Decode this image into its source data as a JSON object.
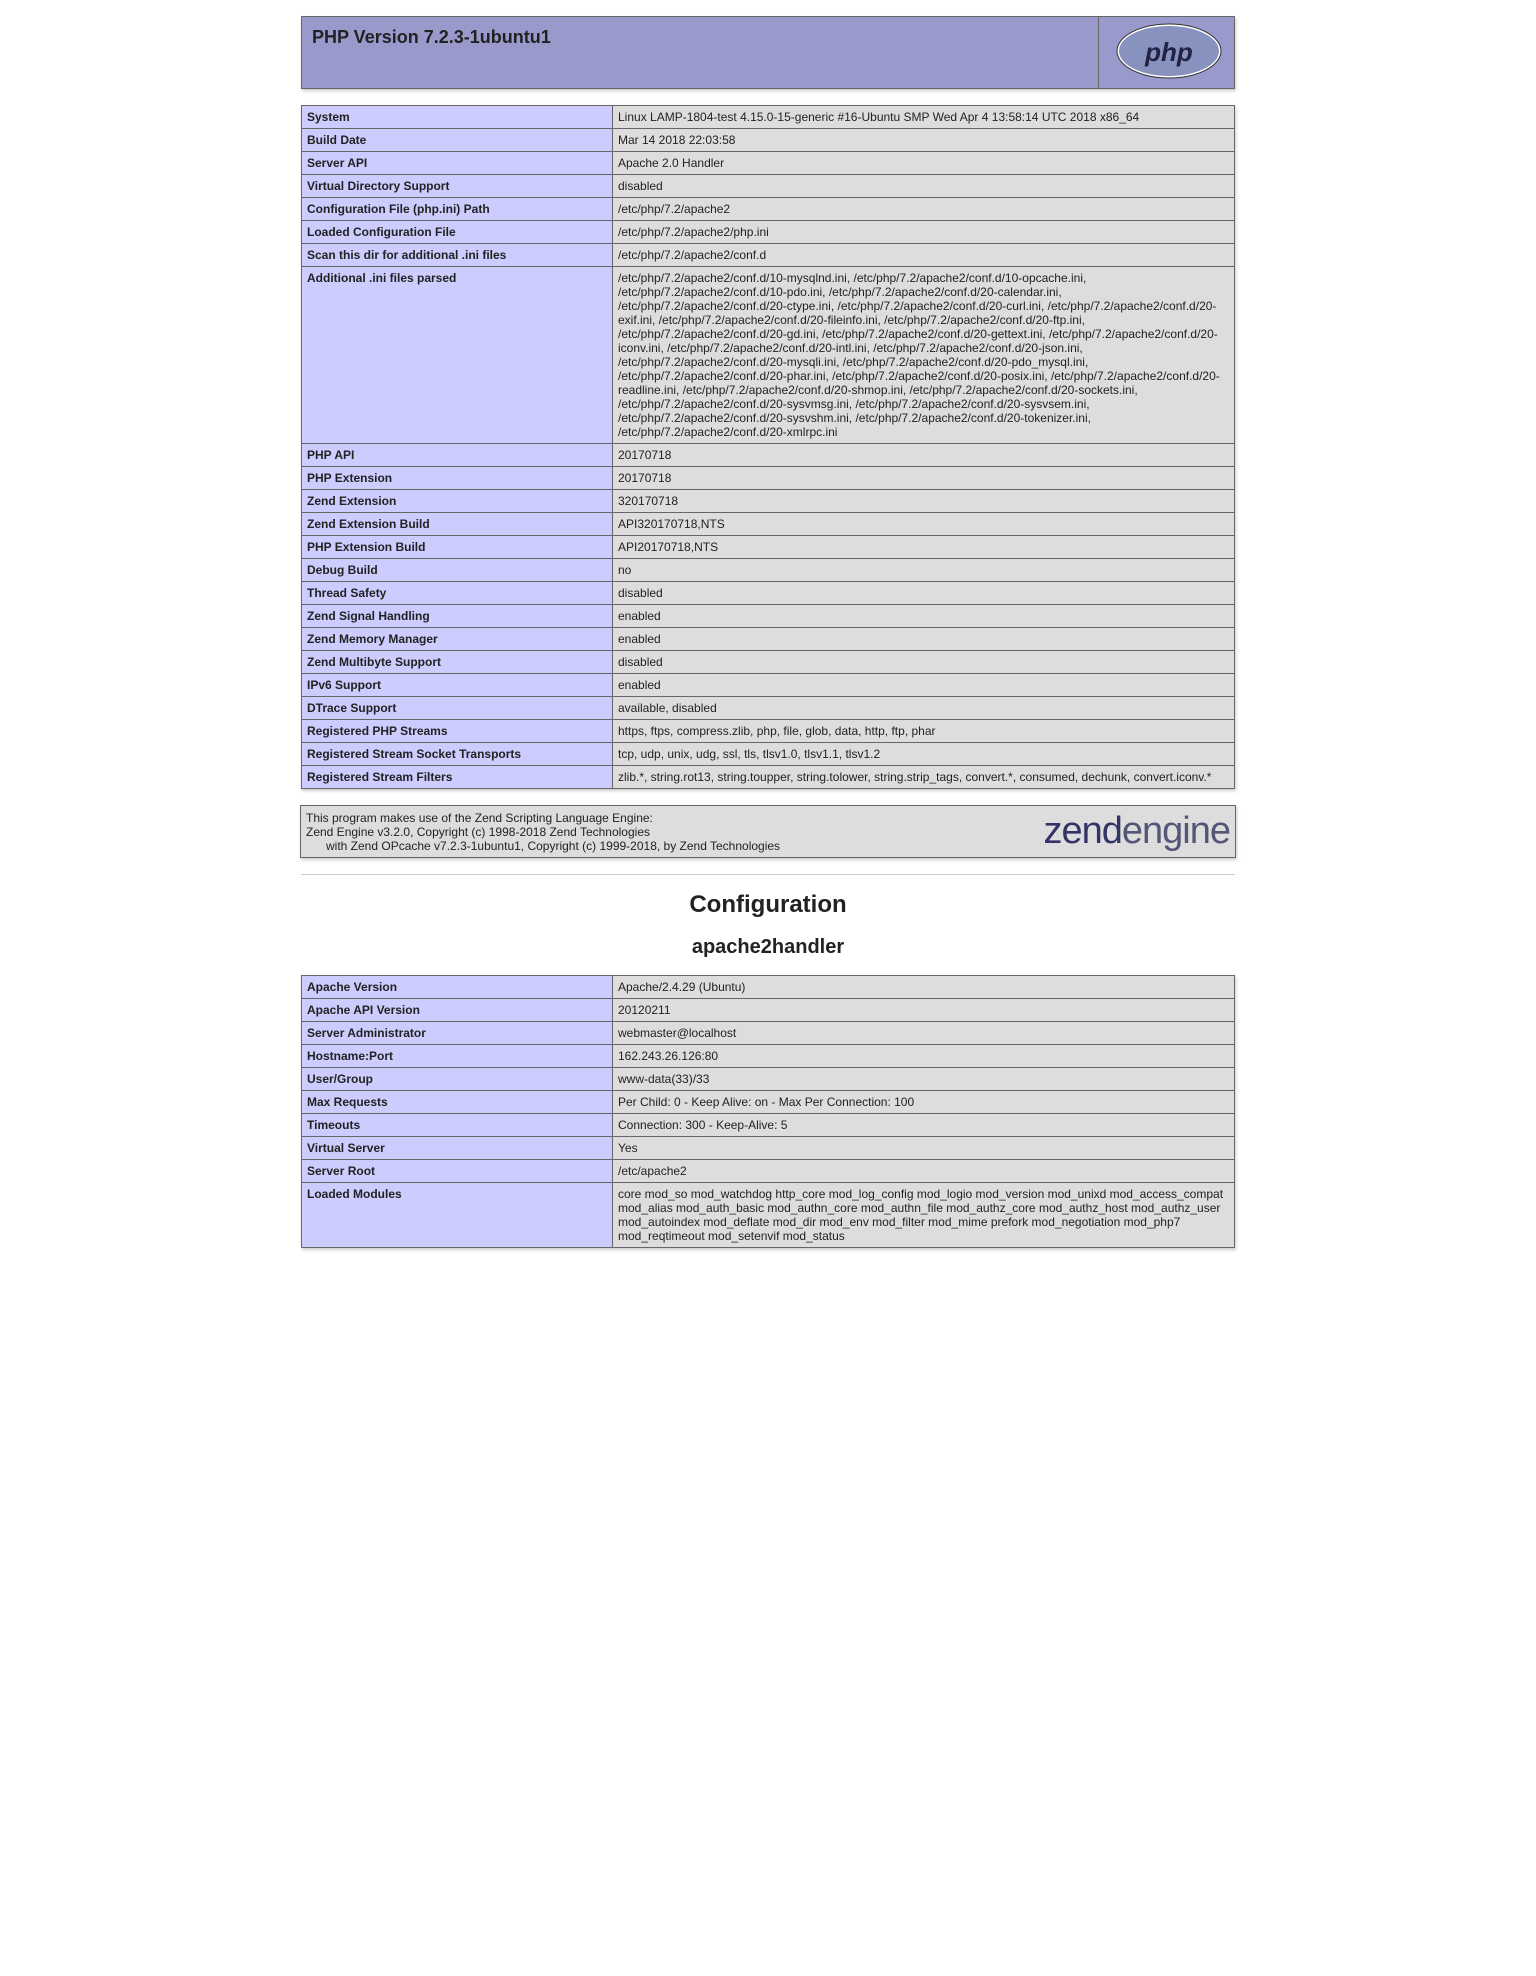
{
  "header": {
    "title": "PHP Version 7.2.3-1ubuntu1"
  },
  "main_table": [
    {
      "name": "System",
      "value": "Linux LAMP-1804-test 4.15.0-15-generic #16-Ubuntu SMP Wed Apr 4 13:58:14 UTC 2018 x86_64"
    },
    {
      "name": "Build Date",
      "value": "Mar 14 2018 22:03:58"
    },
    {
      "name": "Server API",
      "value": "Apache 2.0 Handler"
    },
    {
      "name": "Virtual Directory Support",
      "value": "disabled"
    },
    {
      "name": "Configuration File (php.ini) Path",
      "value": "/etc/php/7.2/apache2"
    },
    {
      "name": "Loaded Configuration File",
      "value": "/etc/php/7.2/apache2/php.ini"
    },
    {
      "name": "Scan this dir for additional .ini files",
      "value": "/etc/php/7.2/apache2/conf.d"
    },
    {
      "name": "Additional .ini files parsed",
      "value": "/etc/php/7.2/apache2/conf.d/10-mysqlnd.ini, /etc/php/7.2/apache2/conf.d/10-opcache.ini, /etc/php/7.2/apache2/conf.d/10-pdo.ini, /etc/php/7.2/apache2/conf.d/20-calendar.ini, /etc/php/7.2/apache2/conf.d/20-ctype.ini, /etc/php/7.2/apache2/conf.d/20-curl.ini, /etc/php/7.2/apache2/conf.d/20-exif.ini, /etc/php/7.2/apache2/conf.d/20-fileinfo.ini, /etc/php/7.2/apache2/conf.d/20-ftp.ini, /etc/php/7.2/apache2/conf.d/20-gd.ini, /etc/php/7.2/apache2/conf.d/20-gettext.ini, /etc/php/7.2/apache2/conf.d/20-iconv.ini, /etc/php/7.2/apache2/conf.d/20-intl.ini, /etc/php/7.2/apache2/conf.d/20-json.ini, /etc/php/7.2/apache2/conf.d/20-mysqli.ini, /etc/php/7.2/apache2/conf.d/20-pdo_mysql.ini, /etc/php/7.2/apache2/conf.d/20-phar.ini, /etc/php/7.2/apache2/conf.d/20-posix.ini, /etc/php/7.2/apache2/conf.d/20-readline.ini, /etc/php/7.2/apache2/conf.d/20-shmop.ini, /etc/php/7.2/apache2/conf.d/20-sockets.ini, /etc/php/7.2/apache2/conf.d/20-sysvmsg.ini, /etc/php/7.2/apache2/conf.d/20-sysvsem.ini, /etc/php/7.2/apache2/conf.d/20-sysvshm.ini, /etc/php/7.2/apache2/conf.d/20-tokenizer.ini, /etc/php/7.2/apache2/conf.d/20-xmlrpc.ini"
    },
    {
      "name": "PHP API",
      "value": "20170718"
    },
    {
      "name": "PHP Extension",
      "value": "20170718"
    },
    {
      "name": "Zend Extension",
      "value": "320170718"
    },
    {
      "name": "Zend Extension Build",
      "value": "API320170718,NTS"
    },
    {
      "name": "PHP Extension Build",
      "value": "API20170718,NTS"
    },
    {
      "name": "Debug Build",
      "value": "no"
    },
    {
      "name": "Thread Safety",
      "value": "disabled"
    },
    {
      "name": "Zend Signal Handling",
      "value": "enabled"
    },
    {
      "name": "Zend Memory Manager",
      "value": "enabled"
    },
    {
      "name": "Zend Multibyte Support",
      "value": "disabled"
    },
    {
      "name": "IPv6 Support",
      "value": "enabled"
    },
    {
      "name": "DTrace Support",
      "value": "available, disabled"
    },
    {
      "name": "Registered PHP Streams",
      "value": "https, ftps, compress.zlib, php, file, glob, data, http, ftp, phar"
    },
    {
      "name": "Registered Stream Socket Transports",
      "value": "tcp, udp, unix, udg, ssl, tls, tlsv1.0, tlsv1.1, tlsv1.2"
    },
    {
      "name": "Registered Stream Filters",
      "value": "zlib.*, string.rot13, string.toupper, string.tolower, string.strip_tags, convert.*, consumed, dechunk, convert.iconv.*"
    }
  ],
  "zend": {
    "line1": "This program makes use of the Zend Scripting Language Engine:",
    "line2": "Zend Engine v3.2.0, Copyright (c) 1998-2018 Zend Technologies",
    "line3": "with Zend OPcache v7.2.3-1ubuntu1, Copyright (c) 1999-2018, by Zend Technologies"
  },
  "config_heading": "Configuration",
  "apache_heading": "apache2handler",
  "apache_table": [
    {
      "name": "Apache Version",
      "value": "Apache/2.4.29 (Ubuntu)"
    },
    {
      "name": "Apache API Version",
      "value": "20120211"
    },
    {
      "name": "Server Administrator",
      "value": "webmaster@localhost"
    },
    {
      "name": "Hostname:Port",
      "value": "162.243.26.126:80"
    },
    {
      "name": "User/Group",
      "value": "www-data(33)/33"
    },
    {
      "name": "Max Requests",
      "value": "Per Child: 0 - Keep Alive: on - Max Per Connection: 100"
    },
    {
      "name": "Timeouts",
      "value": "Connection: 300 - Keep-Alive: 5"
    },
    {
      "name": "Virtual Server",
      "value": "Yes"
    },
    {
      "name": "Server Root",
      "value": "/etc/apache2"
    },
    {
      "name": "Loaded Modules",
      "value": "core mod_so mod_watchdog http_core mod_log_config mod_logio mod_version mod_unixd mod_access_compat mod_alias mod_auth_basic mod_authn_core mod_authn_file mod_authz_core mod_authz_host mod_authz_user mod_autoindex mod_deflate mod_dir mod_env mod_filter mod_mime prefork mod_negotiation mod_php7 mod_reqtimeout mod_setenvif mod_status"
    }
  ]
}
